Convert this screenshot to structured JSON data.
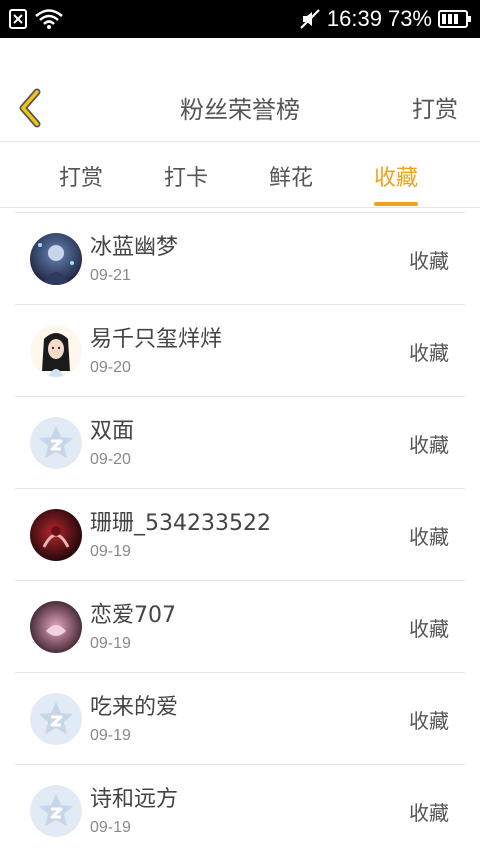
{
  "status_bar": {
    "time": "16:39",
    "battery": "73%",
    "icons": [
      "sim-off-icon",
      "wifi-icon",
      "mute-icon",
      "battery-icon"
    ]
  },
  "header": {
    "title": "粉丝荣誉榜",
    "right_action": "打赏",
    "back_icon": "chevron-left-icon",
    "accent_color": "#f0a31a"
  },
  "tabs": [
    {
      "label": "打赏",
      "active": false
    },
    {
      "label": "打卡",
      "active": false
    },
    {
      "label": "鲜花",
      "active": false
    },
    {
      "label": "收藏",
      "active": true
    }
  ],
  "list": {
    "items": [
      {
        "name": "冰蓝幽梦",
        "date": "09-21",
        "action": "收藏",
        "avatar": "photo-dark-blue"
      },
      {
        "name": "易千只玺烊烊",
        "date": "09-20",
        "action": "收藏",
        "avatar": "photo-anime-girl"
      },
      {
        "name": "双面",
        "date": "09-20",
        "action": "收藏",
        "avatar": "default-logo"
      },
      {
        "name": "珊珊_534233522",
        "date": "09-19",
        "action": "收藏",
        "avatar": "photo-dark-red"
      },
      {
        "name": "恋爱707",
        "date": "09-19",
        "action": "收藏",
        "avatar": "photo-pink-dark"
      },
      {
        "name": "吃来的爱",
        "date": "09-19",
        "action": "收藏",
        "avatar": "default-logo"
      },
      {
        "name": "诗和远方",
        "date": "09-19",
        "action": "收藏",
        "avatar": "default-logo"
      }
    ]
  }
}
